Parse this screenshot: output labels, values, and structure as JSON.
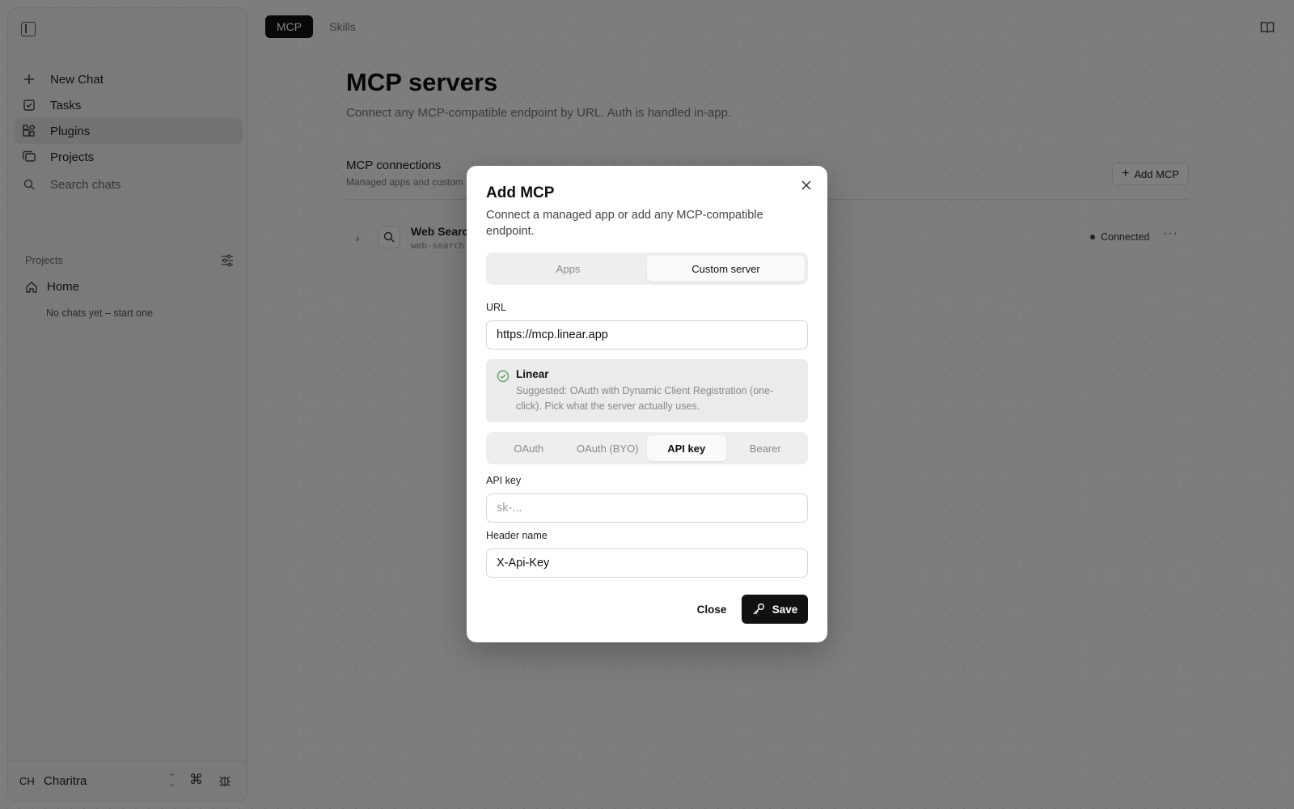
{
  "sidebar": {
    "nav": [
      {
        "label": "New Chat",
        "icon": "plus-icon"
      },
      {
        "label": "Tasks",
        "icon": "checkbox-icon"
      },
      {
        "label": "Plugins",
        "icon": "plugins-icon",
        "active": true
      },
      {
        "label": "Projects",
        "icon": "projects-icon"
      },
      {
        "label": "Search chats",
        "icon": "search-icon"
      }
    ],
    "projects_heading": "Projects",
    "home_label": "Home",
    "empty_text": "No chats yet – start one",
    "user": {
      "initials": "CH",
      "name": "Charitra"
    }
  },
  "top_tabs": [
    {
      "label": "MCP",
      "active": true
    },
    {
      "label": "Skills",
      "active": false
    }
  ],
  "main": {
    "title": "MCP servers",
    "subtitle": "Connect any MCP-compatible endpoint by URL. Auth is handled in-app.",
    "connections_title": "MCP connections",
    "connections_sub": "Managed apps and custom",
    "add_button": "Add MCP",
    "rows": [
      {
        "name": "Web Searc",
        "id": "web-search",
        "status": "Connected"
      }
    ]
  },
  "modal": {
    "title": "Add MCP",
    "description": "Connect a managed app or add any MCP-compatible endpoint.",
    "source_tabs": [
      {
        "label": "Apps",
        "active": false
      },
      {
        "label": "Custom server",
        "active": true
      }
    ],
    "url_label": "URL",
    "url_value": "https://mcp.linear.app",
    "suggestion": {
      "name": "Linear",
      "text": "Suggested: OAuth with Dynamic Client Registration (one-click). Pick what the server actually uses."
    },
    "auth_tabs": [
      {
        "label": "OAuth",
        "active": false
      },
      {
        "label": "OAuth (BYO)",
        "active": false
      },
      {
        "label": "API key",
        "active": true
      },
      {
        "label": "Bearer",
        "active": false
      }
    ],
    "api_key_label": "API key",
    "api_key_placeholder": "sk-...",
    "api_key_value": "",
    "header_label": "Header name",
    "header_value": "X-Api-Key",
    "close_label": "Close",
    "save_label": "Save"
  },
  "colors": {
    "accent": "#111111",
    "overlay": "rgba(0,0,0,0.5)",
    "success": "#5a9a5a"
  }
}
